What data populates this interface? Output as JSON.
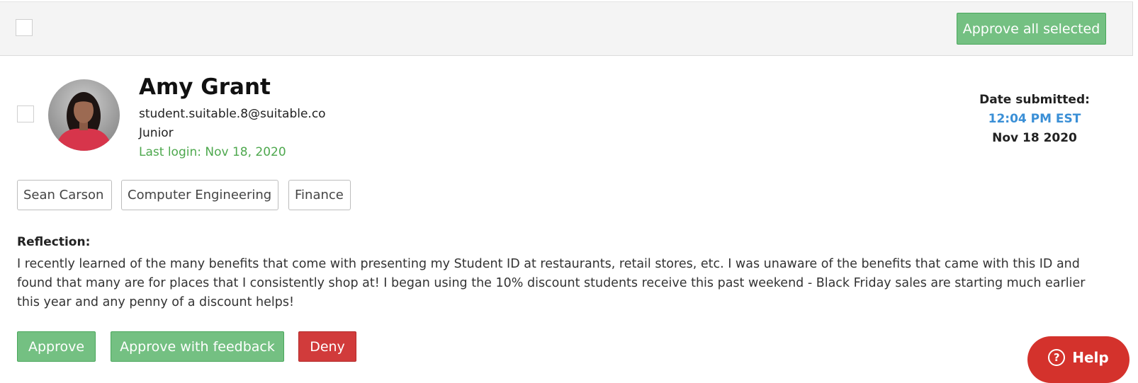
{
  "header": {
    "approve_all_label": "Approve all selected"
  },
  "student": {
    "name": "Amy Grant",
    "email": "student.suitable.8@suitable.co",
    "year": "Junior",
    "last_login": "Last login: Nov 18, 2020"
  },
  "submission": {
    "date_label": "Date submitted:",
    "time": "12:04 PM EST",
    "date": "Nov 18 2020"
  },
  "tags": [
    "Sean Carson",
    "Computer Engineering",
    "Finance"
  ],
  "reflection": {
    "label": "Reflection:",
    "text": "I recently learned of the many benefits that come with presenting my Student ID at restaurants, retail stores, etc. I was unaware of the benefits that came with this ID and found that many are for places that I consistently shop at! I began using the 10% discount students receive this past weekend - Black Friday sales are starting much earlier this year and any penny of a discount helps!"
  },
  "actions": {
    "approve_label": "Approve",
    "approve_feedback_label": "Approve with feedback",
    "deny_label": "Deny"
  },
  "help": {
    "label": "Help",
    "icon": "question-circle-icon"
  },
  "colors": {
    "green": "#74c082",
    "red": "#d13b3b",
    "blue": "#3a8fd6",
    "login_green": "#4ea84e"
  }
}
